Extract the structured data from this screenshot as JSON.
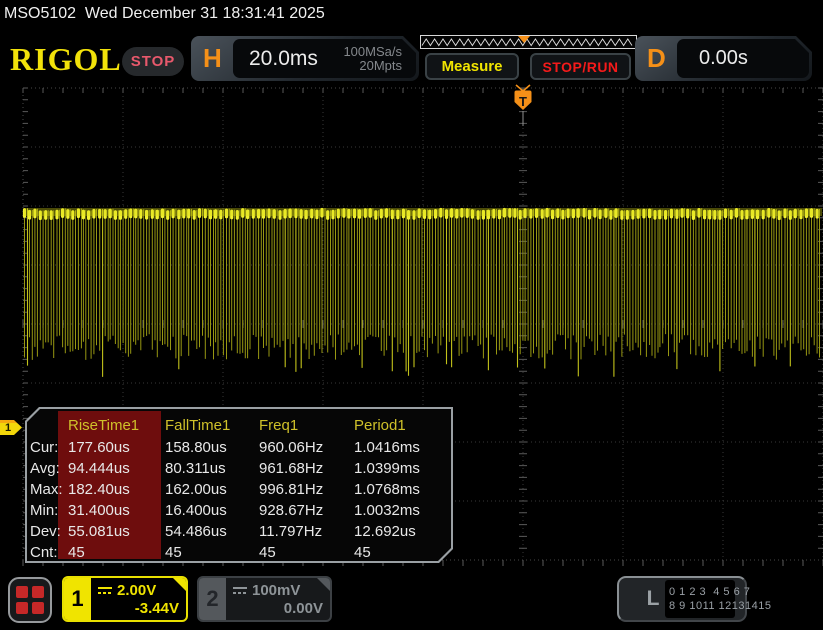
{
  "top_bar": {
    "title": "MSO5102  Wed December 31 18:31:41 2025"
  },
  "header": {
    "logo": "RIGOL",
    "acq_state": "STOP",
    "horizontal": {
      "label": "H",
      "scale": "20.0ms",
      "sample_rate": "100MSa/s",
      "mem_depth": "20Mpts"
    },
    "buttons": {
      "measure": "Measure",
      "stop_run": "STOP/RUN"
    },
    "delay": {
      "label": "D",
      "value": "0.00s"
    }
  },
  "trigger": {
    "marker": "T"
  },
  "measurements": {
    "row_labels": [
      "Cur:",
      "Avg:",
      "Max:",
      "Min:",
      "Dev:",
      "Cnt:"
    ],
    "columns": [
      {
        "name": "RiseTime1",
        "highlighted": true,
        "values": [
          "177.60us",
          "94.444us",
          "182.40us",
          "31.400us",
          "55.081us",
          "45"
        ]
      },
      {
        "name": "FallTime1",
        "highlighted": false,
        "values": [
          "158.80us",
          "80.311us",
          "162.00us",
          "16.400us",
          "54.486us",
          "45"
        ]
      },
      {
        "name": "Freq1",
        "highlighted": false,
        "values": [
          "960.06Hz",
          "961.68Hz",
          "996.81Hz",
          "928.67Hz",
          "11.797Hz",
          "45"
        ]
      },
      {
        "name": "Period1",
        "highlighted": false,
        "values": [
          "1.0416ms",
          "1.0399ms",
          "1.0768ms",
          "1.0032ms",
          "12.692us",
          "45"
        ]
      }
    ]
  },
  "channels": {
    "ch1": {
      "number": "1",
      "scale": "2.00V",
      "offset": "-3.44V"
    },
    "ch2": {
      "number": "2",
      "scale": "100mV",
      "offset": "0.00V"
    },
    "logic": {
      "label": "L",
      "row1": "0 1 2 3  4 5 6 7",
      "row2": "8 9 1011 12131415"
    }
  },
  "colors": {
    "ch1_yellow": "#f0e400",
    "waveform_yellow": "#e8e818",
    "orange_accent": "#f59018",
    "stop_pink": "#e8596c",
    "run_red": "#f51a1a",
    "header_text_yellow": "#cfc12a",
    "highlight_red": "#6e0d0d",
    "ch2_gray": "#8e9498"
  }
}
